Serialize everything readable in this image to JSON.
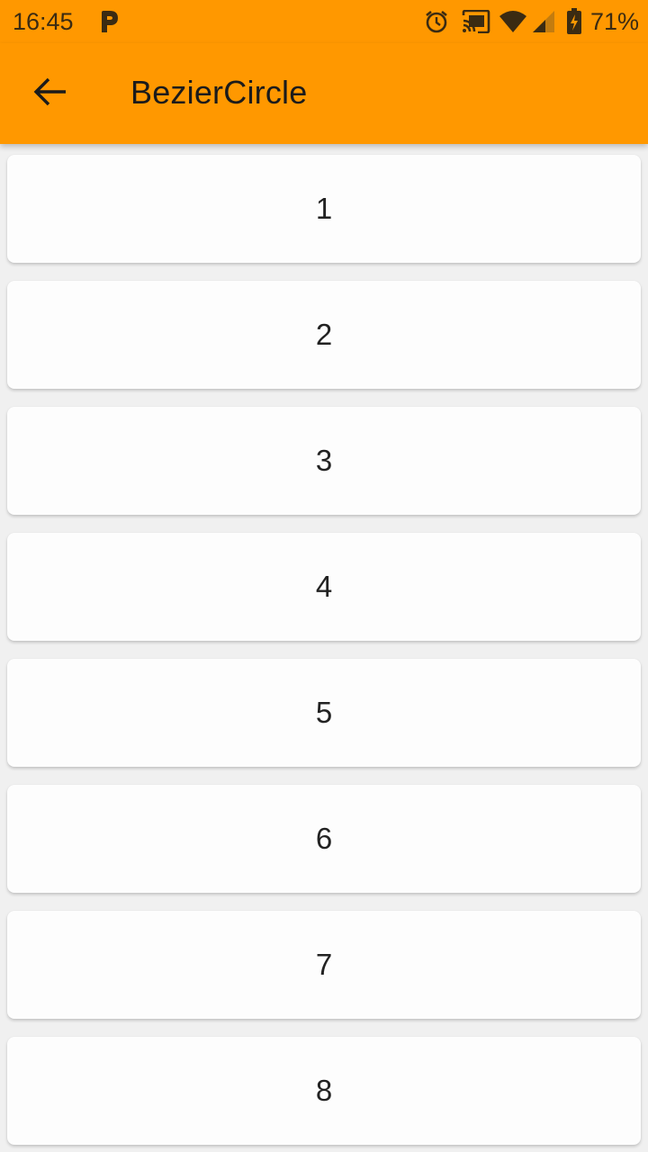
{
  "status_bar": {
    "time": "16:45",
    "notification_icon": "p-app-icon",
    "alarm_icon": "alarm-icon",
    "cast_icon": "cast-icon",
    "wifi_icon": "wifi-icon",
    "signal_icon": "signal-icon",
    "battery_icon": "battery-charging-icon",
    "battery_percent": "71%"
  },
  "app_bar": {
    "back_icon": "arrow-back-icon",
    "title": "BezierCircle",
    "color": "#ff9800"
  },
  "list": {
    "items": [
      {
        "label": "1"
      },
      {
        "label": "2"
      },
      {
        "label": "3"
      },
      {
        "label": "4"
      },
      {
        "label": "5"
      },
      {
        "label": "6"
      },
      {
        "label": "7"
      },
      {
        "label": "8"
      }
    ]
  }
}
